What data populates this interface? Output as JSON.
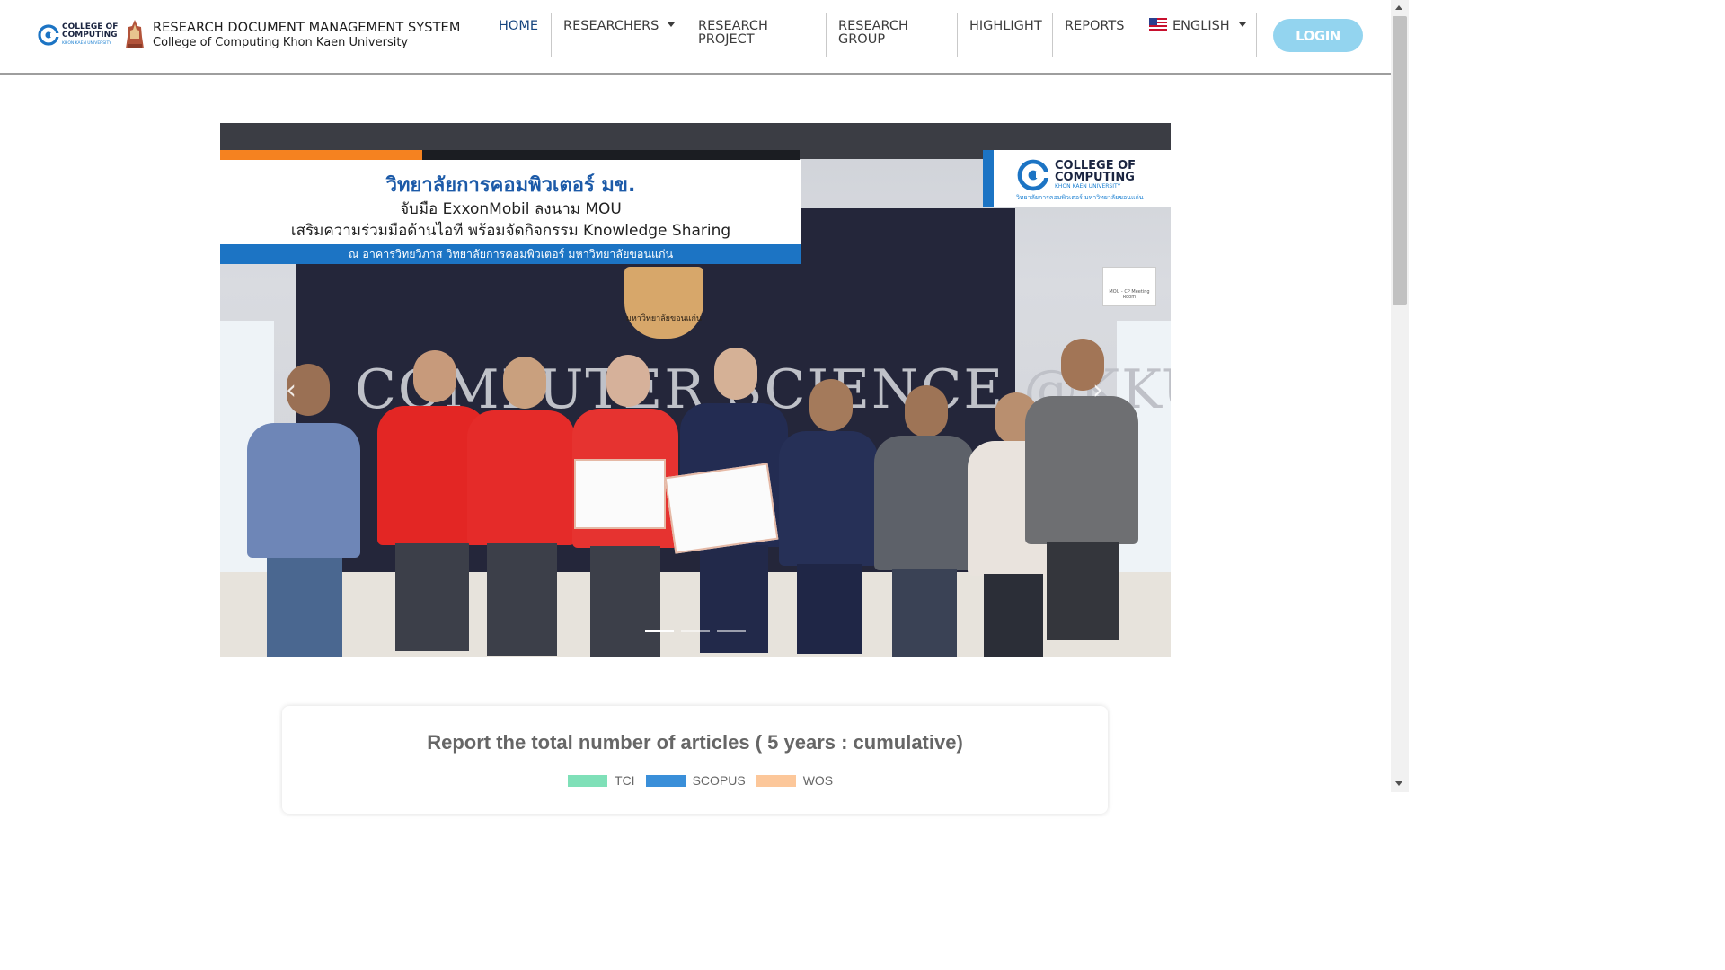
{
  "brand": {
    "logo_line1": "COLLEGE OF",
    "logo_line2": "COMPUTING",
    "logo_line3": "KHON KAEN UNIVERSITY",
    "title": "RESEARCH DOCUMENT MANAGEMENT SYSTEM",
    "subtitle": "College of Computing Khon Kaen University"
  },
  "nav": {
    "home": "HOME",
    "researchers": "RESEARCHERS",
    "research_project_1": "RESEARCH",
    "research_project_2": "PROJECT",
    "research_group_1": "RESEARCH",
    "research_group_2": "GROUP",
    "highlight": "HIGHLIGHT",
    "reports": "REPORTS",
    "language": "ENGLISH",
    "login": "LOGIN"
  },
  "slide": {
    "headline_1": "วิทยาลัยการคอมพิวเตอร์ มข.",
    "headline_2": "จับมือ ExxonMobil ลงนาม MOU",
    "headline_3": "เสริมความร่วมมือด้านไอที พร้อมจัดกิจกรรม Knowledge Sharing",
    "location": "ณ อาคารวิทยวิภาส วิทยาลัยการคอมพิวเตอร์ มหาวิทยาลัยขอนแก่น",
    "card_line1": "COLLEGE OF",
    "card_line2": "COMPUTING",
    "card_line3": "KHON KAEN UNIVERSITY",
    "card_line4": "วิทยาลัยการคอมพิวเตอร์ มหาวิทยาลัยขอนแก่น",
    "wall_text": "COMPUTER SCIENCE @KKU",
    "seal_text": "มหาวิทยาลัยขอนแก่น",
    "sign_text": "MOU - CP Meeting Room",
    "prev": "‹",
    "next": "›",
    "indicator_count": 3,
    "active_indicator": 1
  },
  "report": {
    "title": "Report the total number of articles ( 5 years : cumulative)",
    "legend": [
      {
        "label": "TCI",
        "color": "#7fe0b8"
      },
      {
        "label": "SCOPUS",
        "color": "#3a8fd9"
      },
      {
        "label": "WOS",
        "color": "#fcc79a"
      }
    ]
  },
  "colors": {
    "nav_active": "#16457f",
    "login_bg": "#93d4ef",
    "accent_blue": "#1c74c4"
  }
}
